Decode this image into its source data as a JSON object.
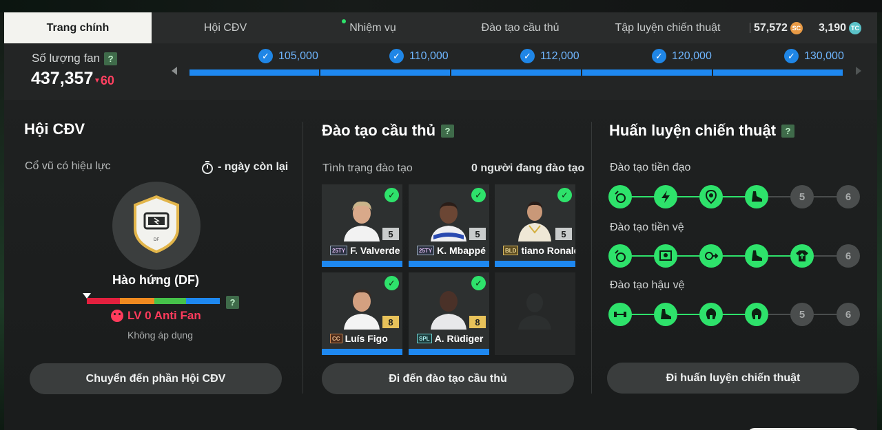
{
  "tabs": [
    {
      "label": "Trang chính",
      "active": true
    },
    {
      "label": "Hội CĐV"
    },
    {
      "label": "Nhiệm vụ",
      "dot": true
    },
    {
      "label": "Đào tạo cầu thủ"
    },
    {
      "label": "Tập luyện chiến thuật"
    }
  ],
  "currency": {
    "sc_amount": "57,572",
    "sc_icon": "SC",
    "tc_amount": "3,190",
    "tc_icon": "TC"
  },
  "fans": {
    "label": "Số lượng fan",
    "help": "?",
    "count": "437,357",
    "delta": "60",
    "milestones": [
      "105,000",
      "110,000",
      "112,000",
      "120,000",
      "130,000"
    ]
  },
  "fanclub": {
    "title": "Hội CĐV",
    "effect_label": "Cổ vũ có hiệu lực",
    "days_left": "- ngày còn lại",
    "badge_code": "DF",
    "mood": "Hào hứng (DF)",
    "level": "LV 0 Anti Fan",
    "status": "Không áp dụng",
    "button": "Chuyển đến phần Hội CĐV",
    "mood_colors": [
      "#e3203e",
      "#f08a20",
      "#46c24a",
      "#1e88f0"
    ]
  },
  "training": {
    "title": "Đào tạo cầu thủ",
    "status_label": "Tình trạng đào tạo",
    "count_label": "0 người đang đào tạo",
    "button": "Đi đến đào tạo cầu thủ",
    "players": [
      {
        "name": "F. Valverde",
        "season": "25TY",
        "ovr": "5"
      },
      {
        "name": "K. Mbappé",
        "season": "25TY",
        "ovr": "5"
      },
      {
        "name": "tiano Ronaldo",
        "season": "BLD",
        "ovr": "5"
      },
      {
        "name": "Luís Figo",
        "season": "CC",
        "ovr": "8"
      },
      {
        "name": "A. Rüdiger",
        "season": "SPL",
        "ovr": "8"
      }
    ]
  },
  "tactics": {
    "title": "Huấn luyện chiến thuật",
    "rows": [
      {
        "label": "Đào tạo tiền đạo",
        "locked": [
          "5",
          "6"
        ]
      },
      {
        "label": "Đào tạo tiền vệ",
        "locked": [
          "6"
        ]
      },
      {
        "label": "Đào tạo hậu vệ",
        "locked": [
          "5",
          "6"
        ]
      }
    ],
    "button": "Đi huấn luyện chiến thuật"
  },
  "colors": {
    "accent_blue": "#1e88f0",
    "accent_green": "#2ee26b",
    "negative_red": "#ff3b5c"
  }
}
